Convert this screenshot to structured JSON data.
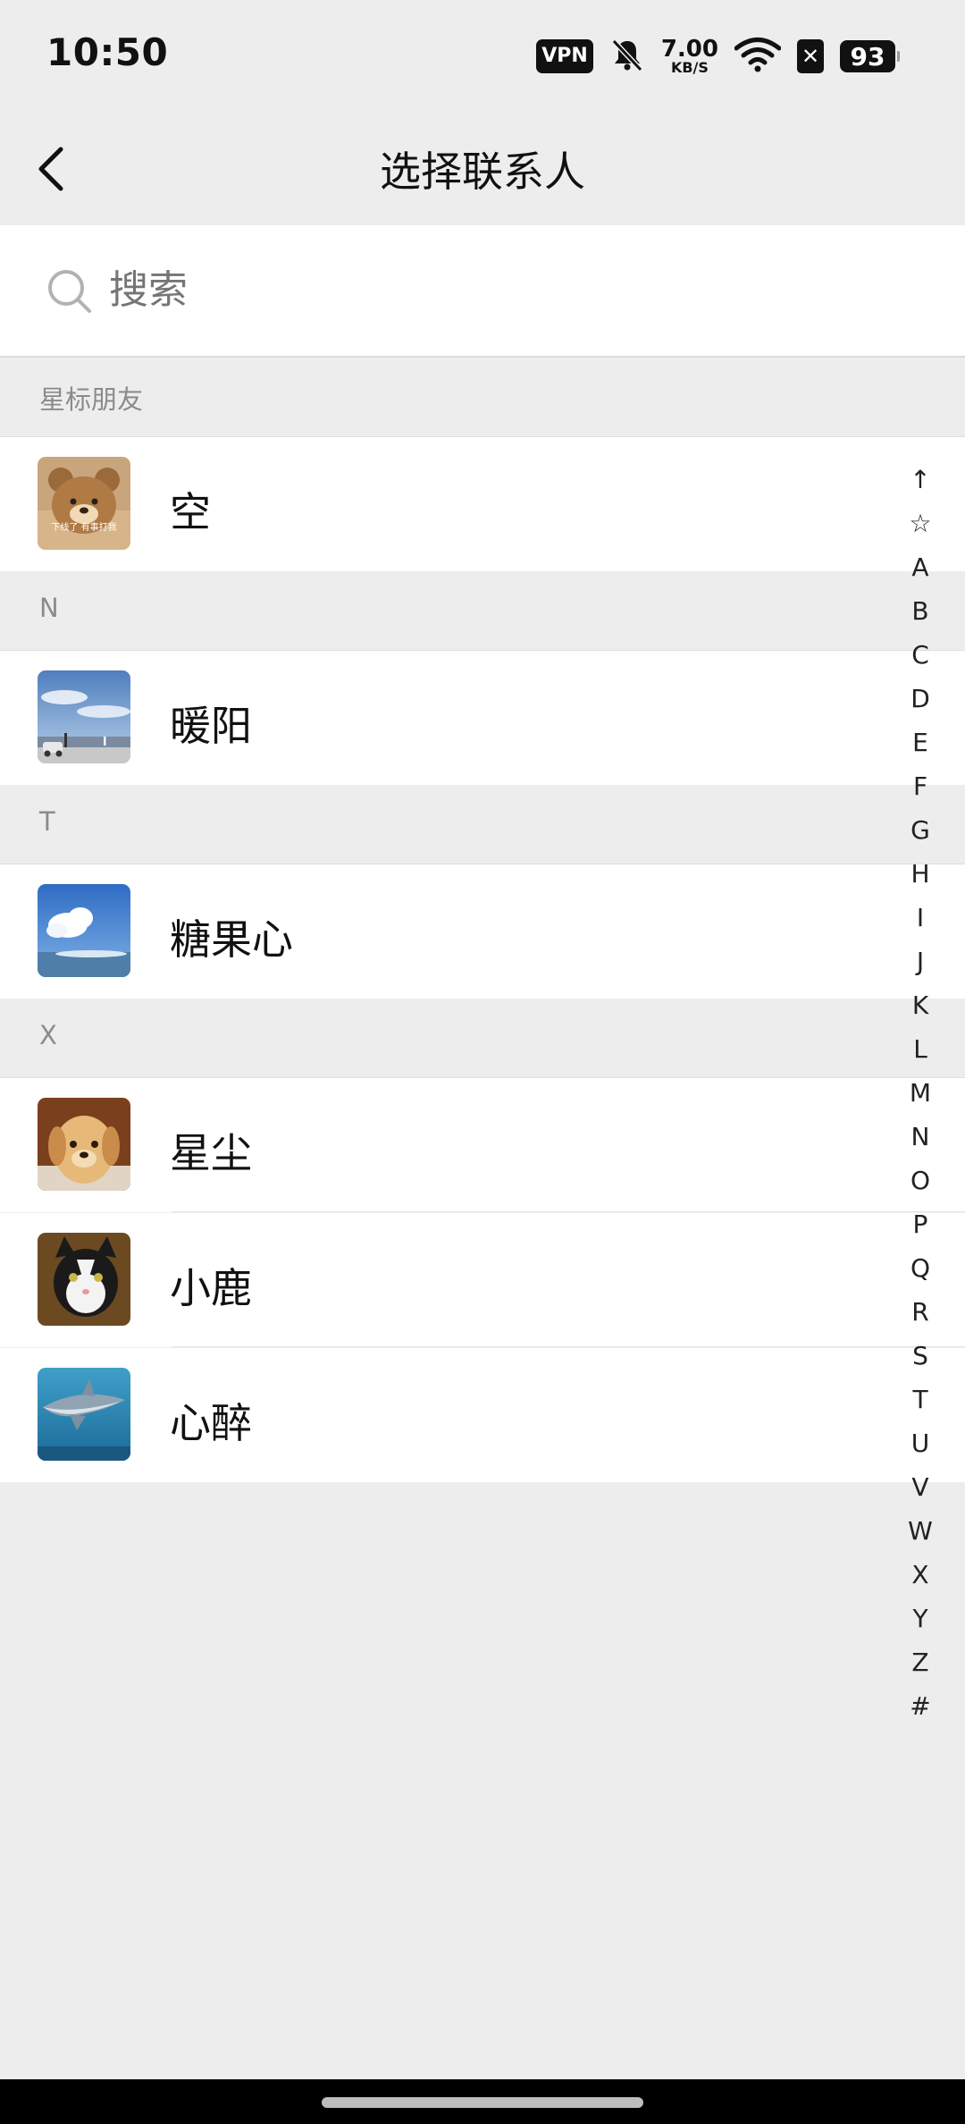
{
  "status_bar": {
    "time": "10:50",
    "vpn": "VPN",
    "speed_value": "7.00",
    "speed_unit": "KB/S",
    "battery": "93",
    "icons": [
      "vpn-icon",
      "bell-mute-icon",
      "network-speed-icon",
      "wifi-icon",
      "no-sim-icon",
      "battery-icon"
    ]
  },
  "nav": {
    "title": "选择联系人",
    "back_icon": "chevron-left-icon"
  },
  "search": {
    "placeholder": "搜索",
    "icon": "search-icon"
  },
  "sections": [
    {
      "header": "星标朋友",
      "contacts": [
        {
          "name": "空"
        }
      ]
    },
    {
      "header": "N",
      "contacts": [
        {
          "name": "暖阳"
        }
      ]
    },
    {
      "header": "T",
      "contacts": [
        {
          "name": "糖果心"
        }
      ]
    },
    {
      "header": "X",
      "contacts": [
        {
          "name": "星尘"
        },
        {
          "name": "小鹿"
        },
        {
          "name": "心醉"
        }
      ]
    }
  ],
  "avatar_overlay_text": "下线了 有事打我",
  "index_bar": [
    "↑",
    "☆",
    "A",
    "B",
    "C",
    "D",
    "E",
    "F",
    "G",
    "H",
    "I",
    "J",
    "K",
    "L",
    "M",
    "N",
    "O",
    "P",
    "Q",
    "R",
    "S",
    "T",
    "U",
    "V",
    "W",
    "X",
    "Y",
    "Z",
    "#"
  ],
  "colors": {
    "background": "#ededed",
    "row": "#ffffff",
    "header_text": "#8b8b8b",
    "placeholder": "#b2b2b2"
  }
}
